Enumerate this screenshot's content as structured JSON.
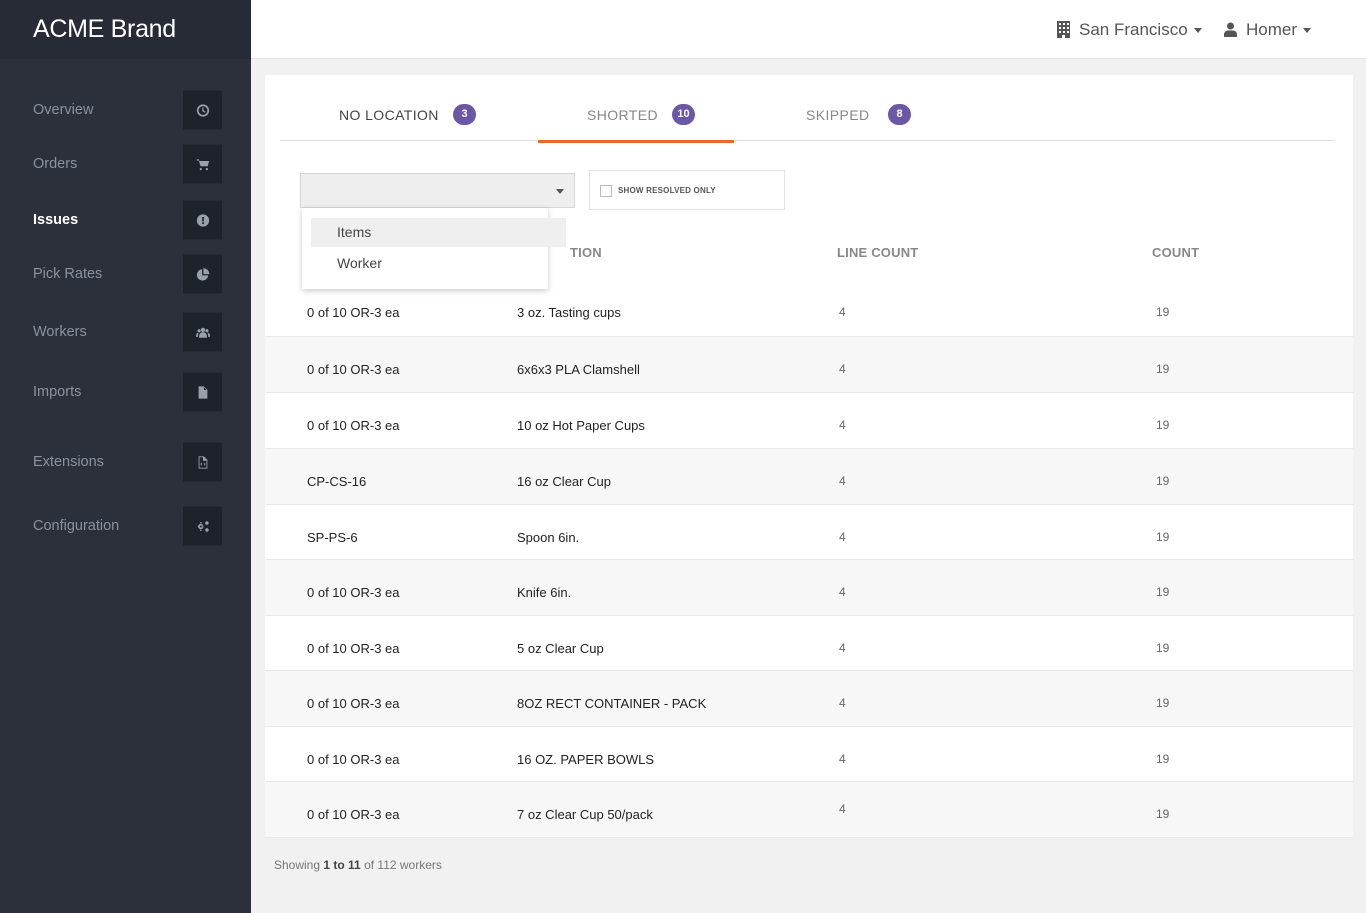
{
  "brand": "ACME Brand",
  "topbar": {
    "location": "San Francisco",
    "user": "Homer"
  },
  "sidebar": {
    "items": [
      {
        "label": "Overview",
        "icon": "clock-icon"
      },
      {
        "label": "Orders",
        "icon": "cart-icon"
      },
      {
        "label": "Issues",
        "icon": "exclamation-icon",
        "active": true
      },
      {
        "label": "Pick Rates",
        "icon": "pie-chart-icon"
      },
      {
        "label": "Workers",
        "icon": "users-icon"
      },
      {
        "label": "Imports",
        "icon": "file-icon"
      },
      {
        "label": "Extensions",
        "icon": "code-file-icon"
      },
      {
        "label": "Configuration",
        "icon": "gears-icon"
      }
    ]
  },
  "tabs": [
    {
      "label": "NO LOCATION",
      "count": "3"
    },
    {
      "label": "SHORTED",
      "count": "10",
      "active": true
    },
    {
      "label": "SKIPPED",
      "count": "8"
    }
  ],
  "filter": {
    "select_value": "",
    "options": [
      "Items",
      "Worker"
    ],
    "checkbox_label": "SHOW RESOLVED ONLY"
  },
  "table": {
    "headers": [
      "TION",
      "LINE COUNT",
      "COUNT"
    ],
    "rows": [
      [
        "0 of 10 OR-3 ea",
        "3 oz. Tasting cups",
        "4",
        "19"
      ],
      [
        "0 of 10 OR-3 ea",
        "6x6x3 PLA Clamshell",
        "4",
        "19"
      ],
      [
        "0 of 10 OR-3 ea",
        "10 oz Hot Paper Cups",
        "4",
        "19"
      ],
      [
        "CP-CS-16",
        "16 oz Clear Cup",
        "4",
        "19"
      ],
      [
        "SP-PS-6",
        "Spoon 6in.",
        "4",
        "19"
      ],
      [
        "0 of 10 OR-3 ea",
        "Knife 6in.",
        "4",
        "19"
      ],
      [
        "0 of 10 OR-3 ea",
        "5 oz Clear Cup",
        "4",
        "19"
      ],
      [
        "0 of 10 OR-3 ea",
        "8OZ RECT CONTAINER - PACK",
        "4",
        "19"
      ],
      [
        "0 of 10 OR-3 ea",
        "16 OZ. PAPER BOWLS",
        "4",
        "19"
      ],
      [
        "0 of 10 OR-3 ea",
        "7 oz Clear Cup  50/pack",
        "4",
        "19"
      ]
    ]
  },
  "footer": {
    "prefix": "Showing ",
    "range": "1 to 11",
    "middle": " of ",
    "suffix": "112 workers"
  },
  "colors": {
    "sidebar_bg": "#2b303b",
    "badge": "#6b57a6",
    "tab_accent": "#e86a2a"
  }
}
